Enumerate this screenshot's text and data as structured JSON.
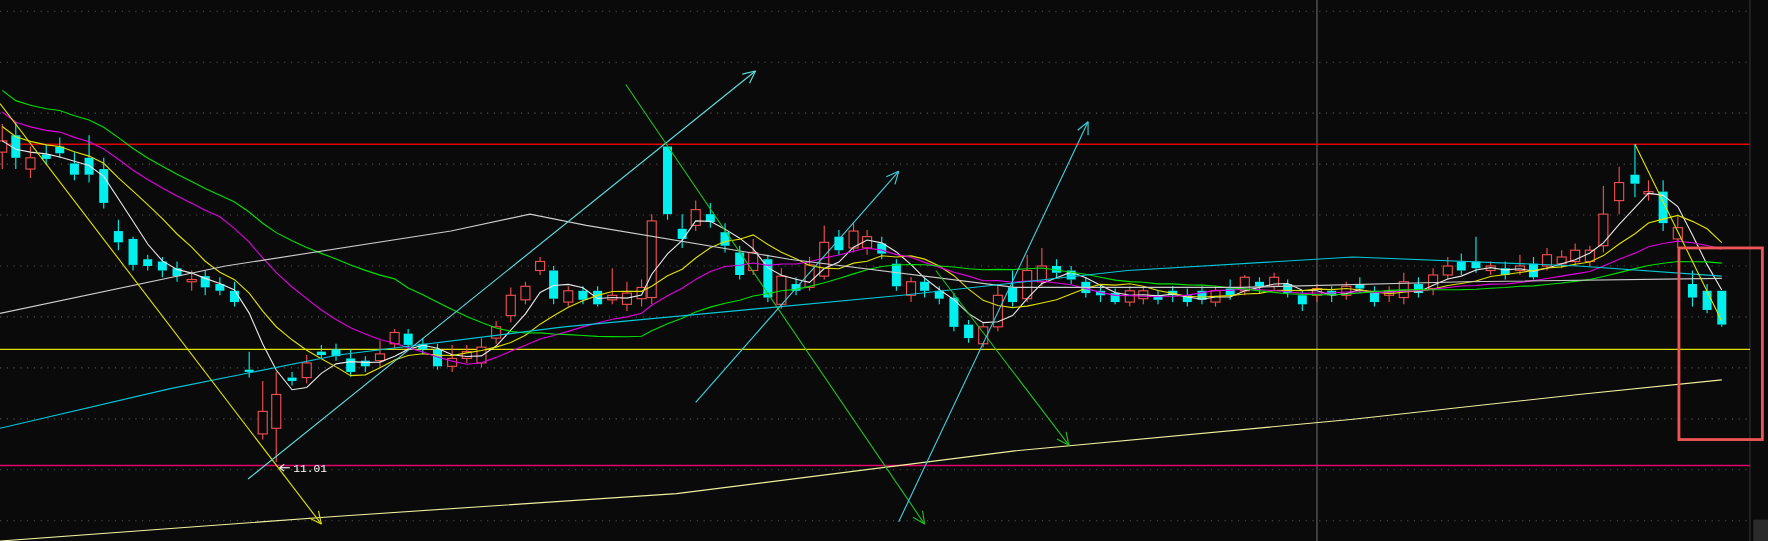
{
  "chart": {
    "low_price_label": "11.01"
  }
}
